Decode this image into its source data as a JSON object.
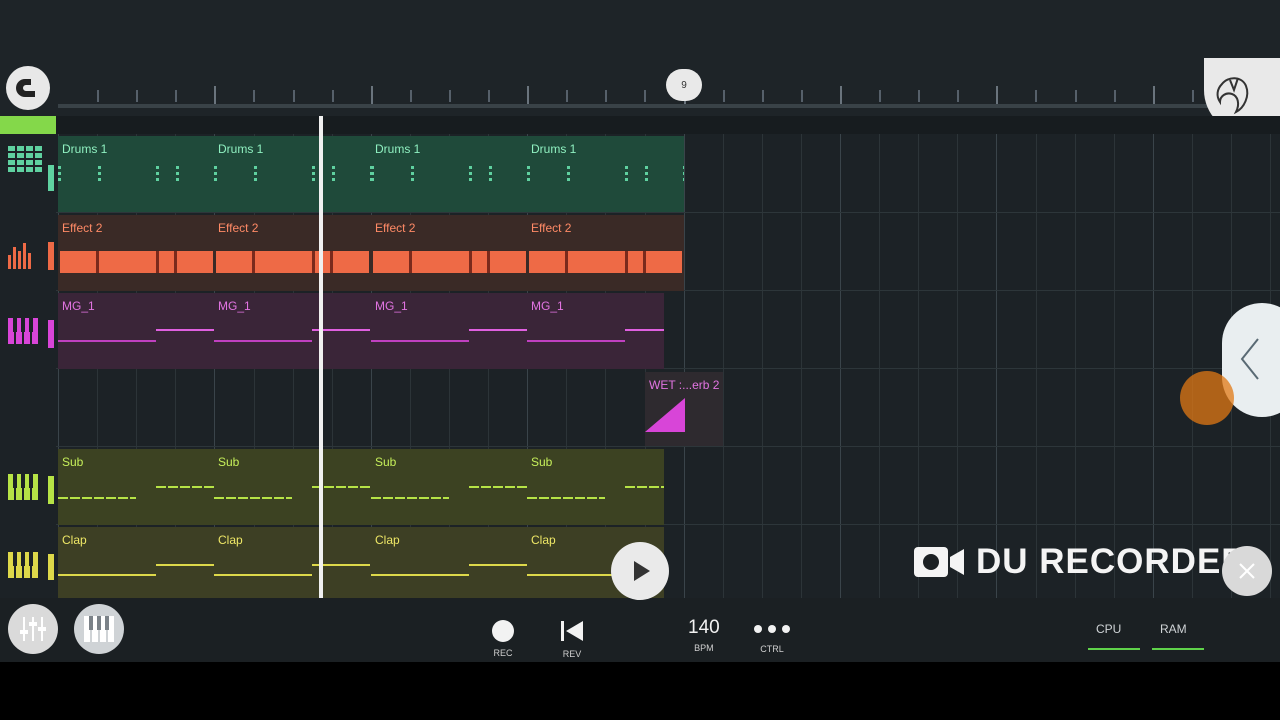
{
  "topbar": {
    "marker_label": "9"
  },
  "tracks": [
    {
      "name": "drums",
      "icon": "drum-pattern-icon",
      "color": "#5fd1a0"
    },
    {
      "name": "effect",
      "icon": "audio-bars-icon",
      "color": "#ee6a46"
    },
    {
      "name": "mg",
      "icon": "piano-roll-icon",
      "color": "#d845d8"
    },
    {
      "name": "automation",
      "icon": "",
      "color": "#d845d8"
    },
    {
      "name": "sub",
      "icon": "piano-roll-icon",
      "color": "#b6e346"
    },
    {
      "name": "clap",
      "icon": "piano-roll-icon",
      "color": "#ddd84a"
    }
  ],
  "clips": {
    "drums_label": "Drums 1",
    "effect_label": "Effect 2",
    "mg_label": "MG_1",
    "automation_label": "WET :...erb 2",
    "sub_label": "Sub",
    "clap_label": "Clap"
  },
  "transport": {
    "rec_label": "REC",
    "rev_label": "REV",
    "bpm_value": "140",
    "bpm_label": "BPM",
    "ctrl_label": "CTRL"
  },
  "overlay": {
    "watermark": "DU RECORDER",
    "cpu_label": "CPU",
    "ram_label": "RAM"
  },
  "colors": {
    "drums_clip": "#1f4a3a",
    "effect_clip": "#3a2a26",
    "mg_clip": "#3a2538",
    "sub_clip": "#3c4222",
    "clap_clip": "#3d3f24",
    "accent_green": "#84d84a"
  }
}
